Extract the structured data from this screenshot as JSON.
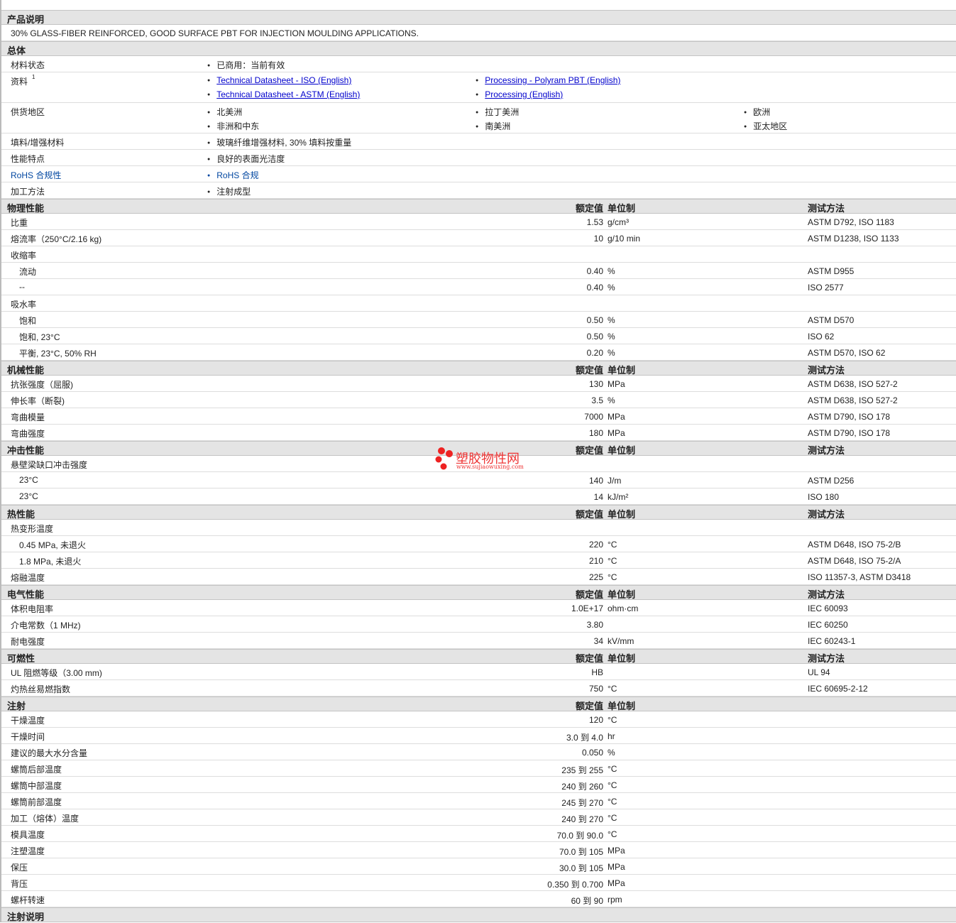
{
  "description_title": "产品说明",
  "description": "30% GLASS-FIBER REINFORCED, GOOD SURFACE PBT FOR INJECTION MOULDING APPLICATIONS.",
  "general": {
    "title": "总体",
    "rows": [
      {
        "label": "材料状态",
        "items": [
          "已商用：当前有效"
        ]
      },
      {
        "label": "资料",
        "sup": "1",
        "links": true,
        "items": [
          "Technical Datasheet - ISO (English)",
          "Processing - Polyram PBT (English)",
          "Technical Datasheet - ASTM (English)",
          "Processing (English)"
        ]
      },
      {
        "label": "供货地区",
        "items": [
          "北美洲",
          "拉丁美洲",
          "欧洲",
          "非洲和中东",
          "南美洲",
          "亚太地区"
        ],
        "cols": 3
      },
      {
        "label": "填料/增强材料",
        "items": [
          "玻璃纤维增强材料, 30% 填料按重量"
        ]
      },
      {
        "label": "性能特点",
        "items": [
          "良好的表面光洁度"
        ]
      },
      {
        "label": "RoHS 合规性",
        "items": [
          "RoHS 合规"
        ],
        "rohs": true
      },
      {
        "label": "加工方法",
        "items": [
          "注射成型"
        ]
      }
    ]
  },
  "headers": {
    "value": "额定值",
    "unit": "单位制",
    "method": "测试方法"
  },
  "sections": [
    {
      "title": "物理性能",
      "method": true,
      "rows": [
        {
          "label": "比重",
          "value": "1.53",
          "unit": "g/cm³",
          "method": "ASTM D792, ISO 1183"
        },
        {
          "label": "熔流率（250°C/2.16 kg)",
          "value": "10",
          "unit": "g/10 min",
          "method": "ASTM D1238, ISO 1133"
        },
        {
          "label": "收缩率"
        },
        {
          "label": "流动",
          "sub": true,
          "value": "0.40",
          "unit": "%",
          "method": "ASTM D955"
        },
        {
          "label": "--",
          "sub": true,
          "value": "0.40",
          "unit": "%",
          "method": "ISO 2577"
        },
        {
          "label": "吸水率"
        },
        {
          "label": "饱和",
          "sub": true,
          "value": "0.50",
          "unit": "%",
          "method": "ASTM D570"
        },
        {
          "label": "饱和, 23°C",
          "sub": true,
          "value": "0.50",
          "unit": "%",
          "method": "ISO 62"
        },
        {
          "label": "平衡, 23°C, 50% RH",
          "sub": true,
          "value": "0.20",
          "unit": "%",
          "method": "ASTM D570, ISO 62"
        }
      ]
    },
    {
      "title": "机械性能",
      "method": true,
      "rows": [
        {
          "label": "抗张强度（屈服)",
          "value": "130",
          "unit": "MPa",
          "method": "ASTM D638, ISO 527-2"
        },
        {
          "label": "伸长率（断裂)",
          "value": "3.5",
          "unit": "%",
          "method": "ASTM D638, ISO 527-2"
        },
        {
          "label": "弯曲模量",
          "value": "7000",
          "unit": "MPa",
          "method": "ASTM D790, ISO 178"
        },
        {
          "label": "弯曲强度",
          "value": "180",
          "unit": "MPa",
          "method": "ASTM D790, ISO 178"
        }
      ]
    },
    {
      "title": "冲击性能",
      "method": true,
      "rows": [
        {
          "label": "悬壁梁缺口冲击强度"
        },
        {
          "label": "23°C",
          "sub": true,
          "value": "140",
          "unit": "J/m",
          "method": "ASTM D256"
        },
        {
          "label": "23°C",
          "sub": true,
          "value": "14",
          "unit": "kJ/m²",
          "method": "ISO 180"
        }
      ]
    },
    {
      "title": "热性能",
      "method": true,
      "rows": [
        {
          "label": "热变形温度"
        },
        {
          "label": "0.45 MPa, 未退火",
          "sub": true,
          "value": "220",
          "unit": "°C",
          "method": "ASTM D648, ISO 75-2/B"
        },
        {
          "label": "1.8 MPa, 未退火",
          "sub": true,
          "value": "210",
          "unit": "°C",
          "method": "ASTM D648, ISO 75-2/A"
        },
        {
          "label": "熔融温度",
          "value": "225",
          "unit": "°C",
          "method": "ISO 11357-3, ASTM D3418"
        }
      ]
    },
    {
      "title": "电气性能",
      "method": true,
      "rows": [
        {
          "label": "体积电阻率",
          "value": "1.0E+17",
          "unit": "ohm·cm",
          "method": "IEC 60093"
        },
        {
          "label": "介电常数（1 MHz)",
          "value": "3.80",
          "unit": "",
          "method": "IEC 60250"
        },
        {
          "label": "耐电强度",
          "value": "34",
          "unit": "kV/mm",
          "method": "IEC 60243-1"
        }
      ]
    },
    {
      "title": "可燃性",
      "method": true,
      "rows": [
        {
          "label": "UL 阻燃等级（3.00 mm)",
          "value": "HB",
          "unit": "",
          "method": "UL 94"
        },
        {
          "label": "灼热丝易燃指数",
          "value": "750",
          "unit": "°C",
          "method": "IEC 60695-2-12"
        }
      ]
    },
    {
      "title": "注射",
      "method": false,
      "rows": [
        {
          "label": "干燥温度",
          "value": "120",
          "unit": "°C"
        },
        {
          "label": "干燥时间",
          "value": "3.0 到  4.0",
          "unit": "hr"
        },
        {
          "label": "建议的最大水分含量",
          "value": "0.050",
          "unit": "%"
        },
        {
          "label": "螺筒后部温度",
          "value": "235 到  255",
          "unit": "°C"
        },
        {
          "label": "螺筒中部温度",
          "value": "240 到  260",
          "unit": "°C"
        },
        {
          "label": "螺筒前部温度",
          "value": "245 到  270",
          "unit": "°C"
        },
        {
          "label": "加工（熔体）温度",
          "value": "240 到  270",
          "unit": "°C"
        },
        {
          "label": "模具温度",
          "value": "70.0 到  90.0",
          "unit": "°C"
        },
        {
          "label": "注塑温度",
          "value": "70.0 到  105",
          "unit": "MPa"
        },
        {
          "label": "保压",
          "value": "30.0 到  105",
          "unit": "MPa"
        },
        {
          "label": "背压",
          "value": "0.350 到  0.700",
          "unit": "MPa"
        },
        {
          "label": "螺杆转速",
          "value": "60 到  90",
          "unit": "rpm"
        }
      ]
    },
    {
      "title": "注射说明",
      "method": false,
      "header_only": true,
      "rows": []
    }
  ],
  "watermark": {
    "name": "塑胶物性网",
    "url": "www.sujiaowuxing.com"
  }
}
